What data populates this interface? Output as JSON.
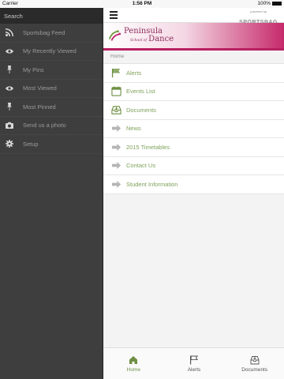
{
  "status": {
    "carrier": "Carrier",
    "time": "1:56 PM",
    "battery": "100%"
  },
  "sidebar": {
    "search_label": "Search",
    "items": [
      {
        "label": "Sportsbag Feed",
        "icon": "rss-icon"
      },
      {
        "label": "My Recently Viewed",
        "icon": "eye-icon"
      },
      {
        "label": "My Pins",
        "icon": "pin-icon"
      },
      {
        "label": "Most Viewed",
        "icon": "eye-icon"
      },
      {
        "label": "Most Pinned",
        "icon": "pin-icon"
      },
      {
        "label": "Send us a photo",
        "icon": "camera-icon"
      },
      {
        "label": "Setup",
        "icon": "gear-icon"
      }
    ]
  },
  "header": {
    "powered_by": "powered by",
    "brand": "SPORTSBAG"
  },
  "logo": {
    "line1": "Peninsula",
    "small": "School of",
    "line2": "Dance"
  },
  "breadcrumb": "Home",
  "menu": [
    {
      "label": "Alerts",
      "icon": "flag-icon"
    },
    {
      "label": "Events List",
      "icon": "calendar-icon"
    },
    {
      "label": "Documents",
      "icon": "inbox-icon"
    },
    {
      "label": "News",
      "icon": "arrow-right-icon"
    },
    {
      "label": "2015 Timetables",
      "icon": "arrow-right-icon"
    },
    {
      "label": "Contact Us",
      "icon": "arrow-right-icon"
    },
    {
      "label": "Student Information",
      "icon": "arrow-right-icon"
    }
  ],
  "tabs": [
    {
      "label": "Home",
      "icon": "home-icon",
      "active": true
    },
    {
      "label": "Alerts",
      "icon": "flag-icon",
      "active": false
    },
    {
      "label": "Documents",
      "icon": "inbox-icon",
      "active": false
    }
  ],
  "colors": {
    "accent_green": "#7ea25b",
    "brand_pink": "#b82061",
    "sidebar_bg": "#3e3e3e"
  }
}
